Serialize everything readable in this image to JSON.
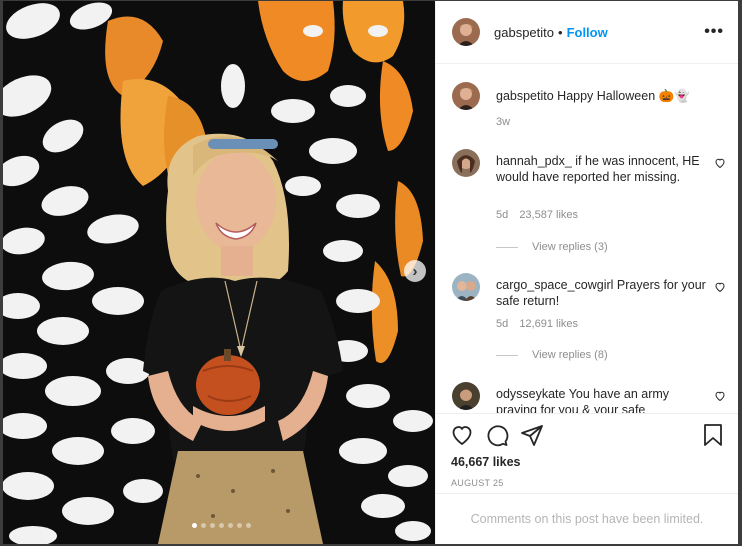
{
  "post": {
    "username": "gabspetito",
    "separator": "•",
    "follow_label": "Follow",
    "more_icon": "•••",
    "caption": "Happy Halloween 🎃👻",
    "caption_age": "3w"
  },
  "comments": [
    {
      "username": "hannah_pdx_",
      "text": "if he was innocent, HE would have reported her missing.",
      "age": "5d",
      "likes": "23,587 likes",
      "replies": "View replies (3)"
    },
    {
      "username": "cargo_space_cowgirl",
      "text": "Prayers for your safe return!",
      "age": "5d",
      "likes": "12,691 likes",
      "replies": "View replies (8)"
    },
    {
      "username": "odysseykate",
      "text": "You have an army praying for you & your safe"
    }
  ],
  "actions": {
    "likes_total": "46,667 likes",
    "date": "AUGUST 25"
  },
  "comments_limited": "Comments on this post have been limited.",
  "carousel": {
    "current": 1,
    "total": 7
  },
  "icons": {
    "like": "heart-icon",
    "comment": "comment-bubble-icon",
    "share": "paper-plane-icon",
    "save": "bookmark-icon",
    "next": "chevron-right-icon",
    "more": "ellipsis-icon"
  },
  "colors": {
    "follow": "#0095f6",
    "muted": "#8e8e8e",
    "text": "#262626"
  }
}
